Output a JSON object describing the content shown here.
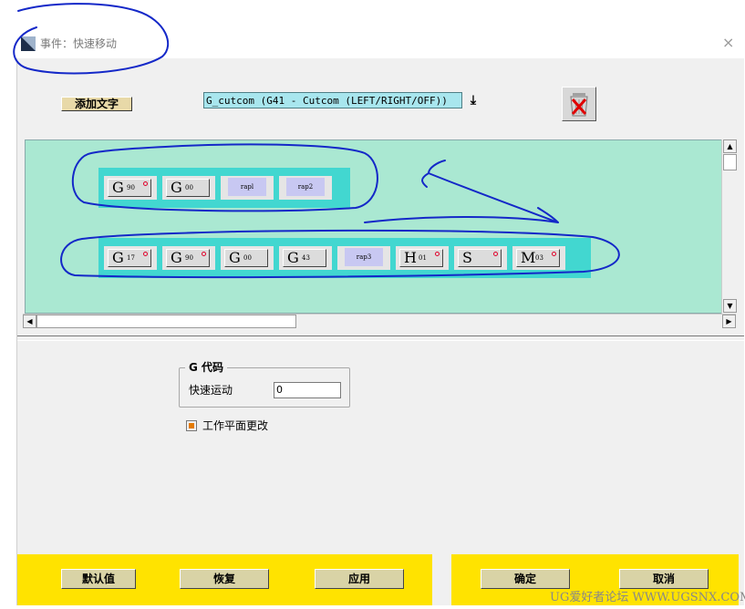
{
  "window": {
    "title": "事件：快速移动",
    "close_glyph": "×"
  },
  "toolbar": {
    "add_text_label": "添加文字",
    "combo_value": "G_cutcom (G41 - Cutcom (LEFT/RIGHT/OFF))",
    "combo_arrow_glyph": "⤓",
    "trash_icon": "recycle-bin-icon"
  },
  "canvas": {
    "row1": [
      {
        "type": "code",
        "letter": "G",
        "num": "90",
        "marked": true
      },
      {
        "type": "code",
        "letter": "G",
        "num": "00",
        "marked": false
      },
      {
        "type": "word",
        "text": "rapl"
      },
      {
        "type": "word",
        "text": "rap2"
      }
    ],
    "row2": [
      {
        "type": "code",
        "letter": "G",
        "num": "17",
        "marked": true
      },
      {
        "type": "code",
        "letter": "G",
        "num": "90",
        "marked": true
      },
      {
        "type": "code",
        "letter": "G",
        "num": "00",
        "marked": false
      },
      {
        "type": "code",
        "letter": "G",
        "num": "43",
        "marked": false
      },
      {
        "type": "word",
        "text": "rap3"
      },
      {
        "type": "code",
        "letter": "H",
        "num": "01",
        "marked": true
      },
      {
        "type": "code",
        "letter": "S",
        "num": "",
        "marked": true
      },
      {
        "type": "code",
        "letter": "M",
        "num": "03",
        "marked": true
      }
    ],
    "row_color": "#42d7d0",
    "background_color": "#aae8d2"
  },
  "group": {
    "title": "G 代码",
    "field_label": "快速运动",
    "field_value": "0"
  },
  "checkbox": {
    "label": "工作平面更改",
    "checked": true
  },
  "buttons": {
    "default_label": "默认值",
    "restore_label": "恢复",
    "apply_label": "应用",
    "ok_label": "确定",
    "cancel_label": "取消"
  },
  "colors": {
    "button_bar": "#ffe300",
    "annotation_ink": "#1428c8"
  },
  "watermark": "UG爱好者论坛 WWW.UGSNX.COM"
}
